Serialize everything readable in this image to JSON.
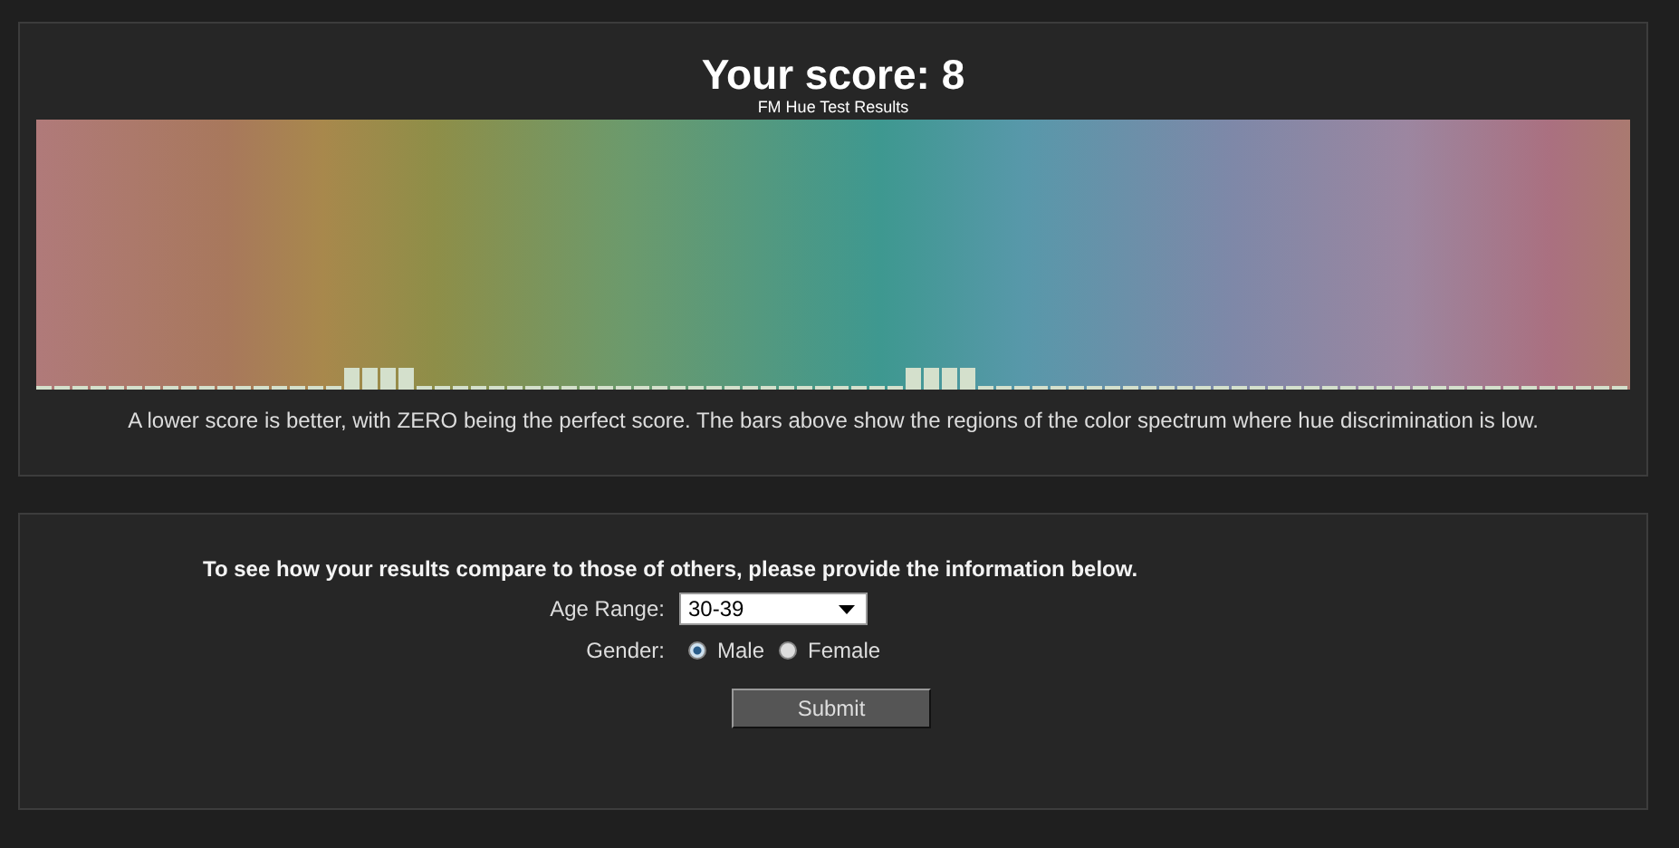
{
  "results": {
    "title": "Your score: 8",
    "subtitle": "FM Hue Test Results",
    "note": "A lower score is better, with ZERO being the perfect score. The bars above show the regions of the color spectrum where hue discrimination is low."
  },
  "form": {
    "intro": "To see how your results compare to those of others, please provide the information below.",
    "age_label": "Age Range:",
    "age_value": "30-39",
    "gender_label": "Gender:",
    "genders": [
      {
        "label": "Male",
        "selected": true
      },
      {
        "label": "Female",
        "selected": false
      }
    ],
    "submit": "Submit"
  }
}
